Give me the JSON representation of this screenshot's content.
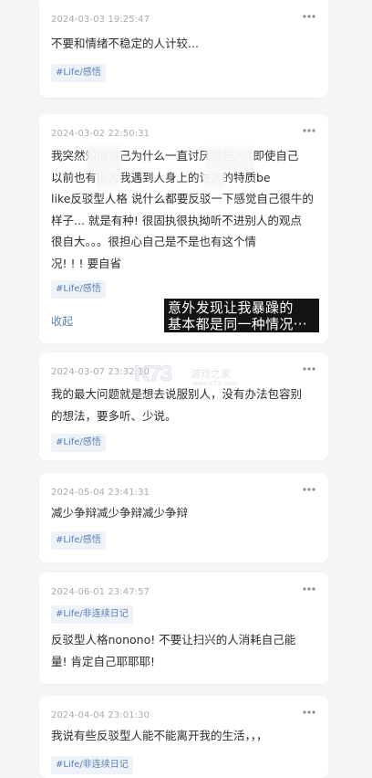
{
  "feed": {
    "cards": [
      {
        "date": "2024-03-03 19:25:47",
        "content": "不要和情绪不稳定的人计较...",
        "tag": "#Life/感悟"
      },
      {
        "date": "2024-03-02 22:50:31",
        "content_lines": [
          "我突然知道自己为什么一直讨厌某些人 (即使自己",
          "以前也有因为我遇到人身上的讨厌的特质be",
          "like反驳型人格 说什么都要反驳一下感觉自己很牛的",
          "样子... 就是有种! 很固执很执拗听不进别人的观点",
          "很自大。。。很担心自己是不是也有这个情",
          "况! ! ! 要自省"
        ],
        "tag": "#Life/感悟",
        "collapse_label": "收起"
      },
      {
        "date": "2024-03-07 23:32:10",
        "content_lines": [
          "我的最大问题就是想去说服别人，没有办法包容别",
          "的想法，要多听、少说。"
        ],
        "tag": "#Life/感悟"
      },
      {
        "date": "2024-05-04 23:41:31",
        "content": "减少争辩减少争辩减少争辩",
        "tag": "#Life/感悟"
      },
      {
        "date": "2024-06-01 23:47:57",
        "tag": "#Life/非连续日记",
        "content_lines": [
          "反驳型人格nonono! 不要让扫兴的人消耗自己能",
          "量! 肯定自己耶耶耶!"
        ]
      },
      {
        "date": "2024-04-04 23:01:30",
        "content": "我说有些反驳型人能不能离开我的生活，，，",
        "tag": "#Life/非连续日记"
      }
    ]
  },
  "overlay_caption": {
    "line1": "意外发现让我暴躁的",
    "line2": "基本都是同一种情况···"
  },
  "watermark": {
    "logo": "K73",
    "cn": "游戏之家",
    "url": "www.k73.com"
  },
  "icons": {
    "more": "more-dots-icon"
  }
}
